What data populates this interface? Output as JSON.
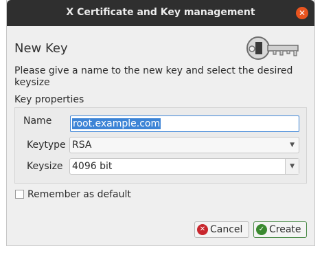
{
  "window": {
    "title": "X Certificate and Key management",
    "close_glyph": "✕"
  },
  "dialog": {
    "heading": "New Key",
    "description": "Please give a name to the new key and select the desired keysize",
    "key_icon": "key-icon"
  },
  "properties": {
    "group_label": "Key properties",
    "name_label": "Name",
    "name_value": "root.example.com",
    "keytype_label": "Keytype",
    "keytype_value": "RSA",
    "keysize_label": "Keysize",
    "keysize_value": "4096 bit"
  },
  "options": {
    "remember_label": "Remember as default",
    "remember_checked": false
  },
  "buttons": {
    "cancel_label": "Cancel",
    "create_label": "Create"
  },
  "colors": {
    "accent": "#3d84d6",
    "close": "#e9541f",
    "cancel_icon": "#c8262d",
    "ok_icon": "#3a8a2f"
  }
}
